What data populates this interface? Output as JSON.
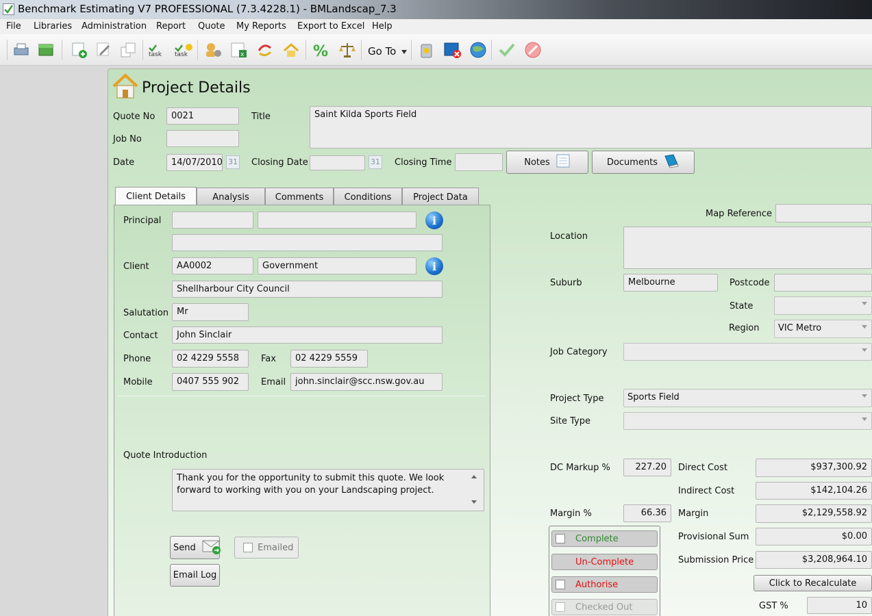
{
  "window": {
    "title": "Benchmark Estimating V7 PROFESSIONAL (7.3.4228.1) - BMLandscap_7.3"
  },
  "menu": [
    "File",
    "Libraries",
    "Administration",
    "Report",
    "Quote",
    "My Reports",
    "Export to Excel",
    "Help"
  ],
  "toolbar": {
    "goto_label": "Go To",
    "icons": [
      "print-icon",
      "database-icon",
      "new-item-icon",
      "edit-icon",
      "copy-icon",
      "task-icon",
      "task-add-icon",
      "users-settings-icon",
      "excel-export-icon",
      "transfer-icon",
      "house-transfer-icon",
      "percent-icon",
      "scales-icon",
      "recycle-bin-icon",
      "close-window-icon",
      "globe-icon",
      "approve-check-icon",
      "cancel-icon"
    ]
  },
  "page": {
    "title": "Project Details"
  },
  "header": {
    "quote_no_label": "Quote No",
    "quote_no": "0021",
    "title_label": "Title",
    "title": "Saint Kilda Sports Field",
    "job_no_label": "Job No",
    "job_no": "",
    "date_label": "Date",
    "date": "14/07/2010",
    "calendar_day": "31",
    "closing_date_label": "Closing Date",
    "closing_date": "",
    "closing_time_label": "Closing Time",
    "closing_time": "",
    "notes_label": "Notes",
    "documents_label": "Documents"
  },
  "tabs": [
    "Client Details",
    "Analysis",
    "Comments",
    "Conditions",
    "Project Data"
  ],
  "client": {
    "principal_label": "Principal",
    "principal_code": "",
    "principal_name": "",
    "principal_extra": "",
    "client_label": "Client",
    "client_code": "AA0002",
    "client_type": "Government",
    "client_name": "Shellharbour City Council",
    "salutation_label": "Salutation",
    "salutation": "Mr",
    "contact_label": "Contact",
    "contact": "John Sinclair",
    "phone_label": "Phone",
    "phone": "02 4229 5558",
    "fax_label": "Fax",
    "fax": "02 4229 5559",
    "mobile_label": "Mobile",
    "mobile": "0407 555 902",
    "email_label": "Email",
    "email": "john.sinclair@scc.nsw.gov.au",
    "intro_label": "Quote Introduction",
    "intro": "Thank you for the opportunity to submit this quote.  We look forward to working with you on your Landscaping project.",
    "send_label": "Send",
    "emailed_label": "Emailed",
    "email_log_label": "Email Log",
    "info_glyph": "i"
  },
  "project": {
    "map_ref_label": "Map Reference",
    "map_ref": "",
    "location_label": "Location",
    "location": "",
    "suburb_label": "Suburb",
    "suburb": "Melbourne",
    "postcode_label": "Postcode",
    "postcode": "",
    "state_label": "State",
    "state": "",
    "region_label": "Region",
    "region": "VIC Metro",
    "job_category_label": "Job Category",
    "job_category": "",
    "project_type_label": "Project Type",
    "project_type": "Sports Field",
    "site_type_label": "Site Type",
    "site_type": ""
  },
  "financials": {
    "dc_markup_label": "DC Markup %",
    "dc_markup": "227.20",
    "margin_pct_label": "Margin %",
    "margin_pct": "66.36",
    "direct_cost_label": "Direct Cost",
    "direct_cost": "$937,300.92",
    "indirect_cost_label": "Indirect Cost",
    "indirect_cost": "$142,104.26",
    "margin_label": "Margin",
    "margin": "$2,129,558.92",
    "provisional_sum_label": "Provisional Sum",
    "provisional_sum": "$0.00",
    "submission_price_label": "Submission Price",
    "submission_price": "$3,208,964.10",
    "recalc_label": "Click to Recalculate",
    "gst_label": "GST %",
    "gst": "10"
  },
  "status": [
    {
      "label": "Complete",
      "color": "#2f8a2f"
    },
    {
      "label": "Un-Complete",
      "color": "#e01010"
    },
    {
      "label": "Authorise",
      "color": "#e01010"
    },
    {
      "label": "Checked Out",
      "color": "#9a9a9a"
    }
  ]
}
